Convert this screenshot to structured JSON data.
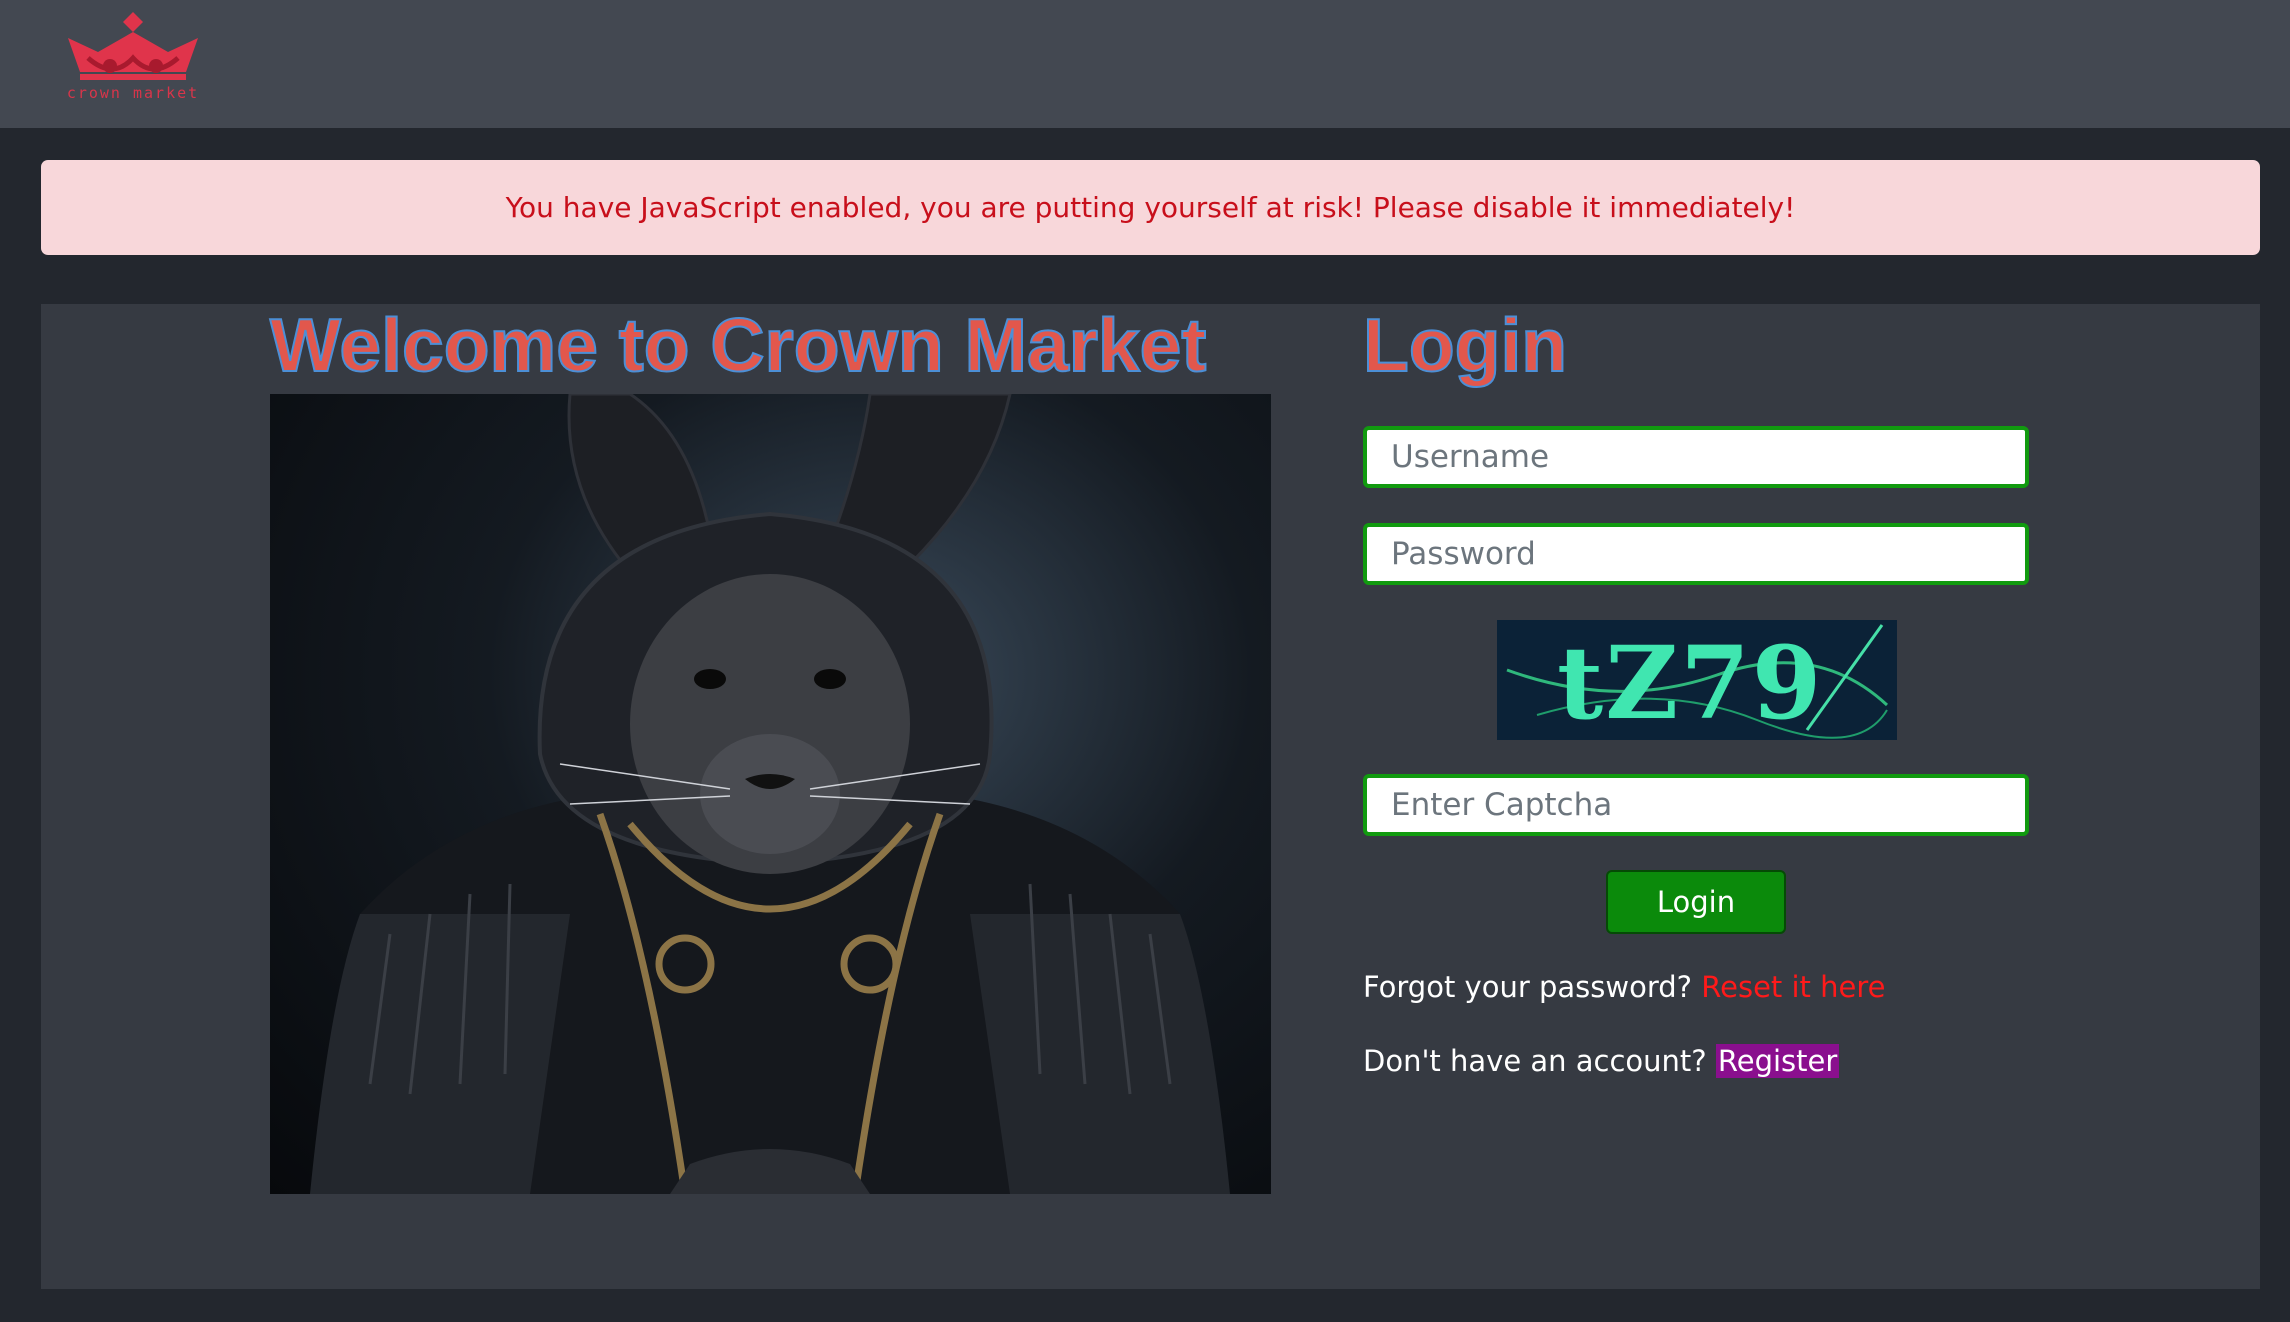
{
  "brand": {
    "logo_icon": "crown-icon",
    "logo_text": "crown market",
    "color": "#d8354a"
  },
  "alert": {
    "message": "You have JavaScript enabled, you are putting yourself at risk! Please disable it immediately!"
  },
  "welcome": {
    "title": "Welcome to Crown Market"
  },
  "login": {
    "title": "Login",
    "username_placeholder": "Username",
    "password_placeholder": "Password",
    "captcha_text": "tZ79",
    "captcha_placeholder": "Enter Captcha",
    "submit_label": "Login",
    "forgot_prompt": "Forgot your password?",
    "reset_link": "Reset it here",
    "register_prompt": "Don't have an account?",
    "register_link": "Register"
  },
  "colors": {
    "accent_red": "#e2574c",
    "field_border": "#119a0f",
    "button_green": "#0b8a0b",
    "register_highlight": "#8a0f8e"
  }
}
